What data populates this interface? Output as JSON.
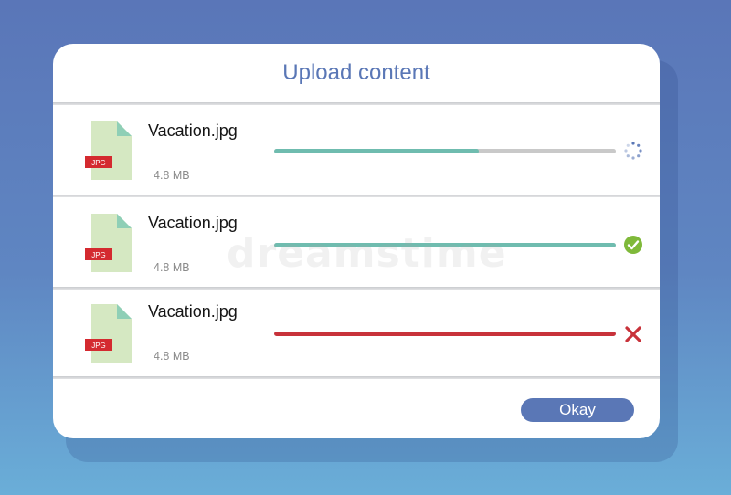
{
  "dialog": {
    "title": "Upload content",
    "okay_label": "Okay"
  },
  "uploads": [
    {
      "name": "Vacation.jpg",
      "size": "4.8 MB",
      "badge": "JPG",
      "progress": 0.6,
      "status": "in-progress",
      "status_icon": "spinner-icon"
    },
    {
      "name": "Vacation.jpg",
      "size": "4.8 MB",
      "badge": "JPG",
      "progress": 1.0,
      "status": "complete",
      "status_icon": "check-circle-icon"
    },
    {
      "name": "Vacation.jpg",
      "size": "4.8 MB",
      "badge": "JPG",
      "progress": 1.0,
      "status": "failed",
      "status_icon": "close-icon"
    }
  ],
  "watermark": "dreamstime",
  "colors": {
    "accent": "#5a77b6",
    "progress_fill": "#6fbcaf",
    "progress_track": "#c9c9c9",
    "error": "#c8323a",
    "success": "#7fb93a",
    "file_icon": "#d5e8c2",
    "badge": "#d42a2f"
  }
}
